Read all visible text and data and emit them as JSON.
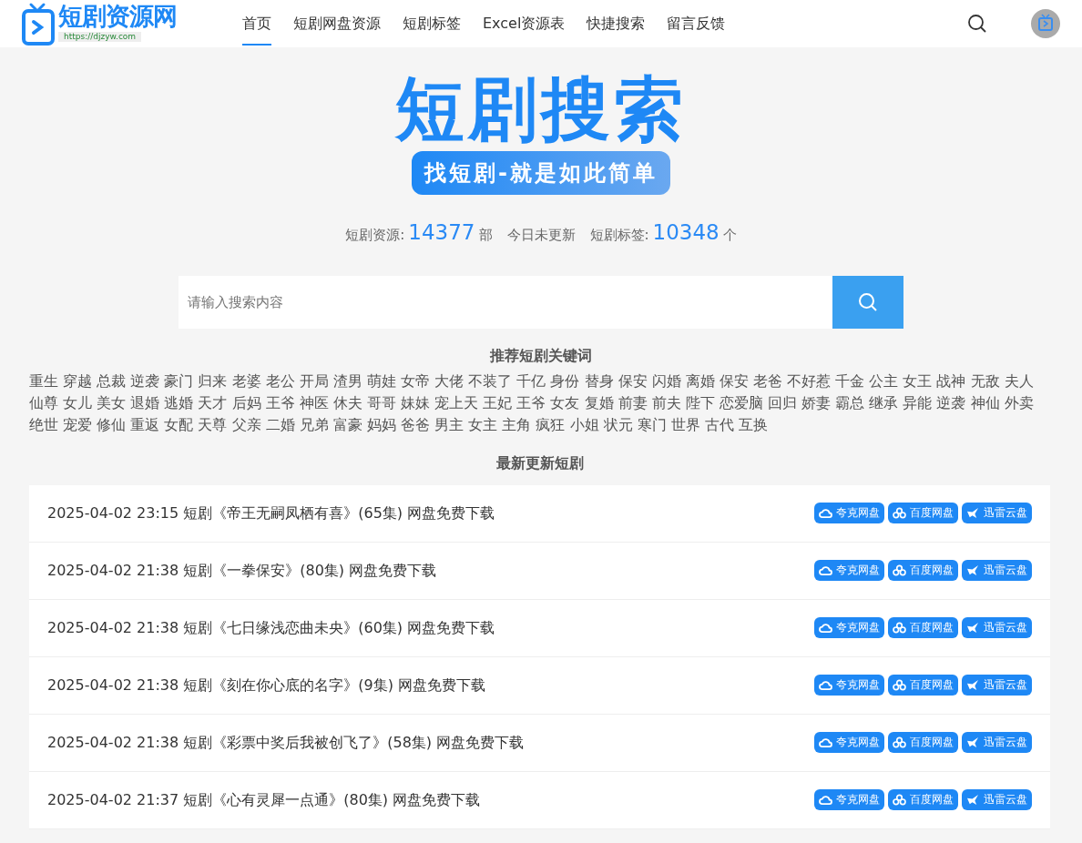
{
  "header": {
    "logo": {
      "name": "短剧资源网",
      "url": "https://djzyw.com"
    },
    "nav": [
      {
        "label": "首页",
        "selected": true
      },
      {
        "label": "短剧网盘资源",
        "selected": false
      },
      {
        "label": "短剧标签",
        "selected": false
      },
      {
        "label": "Excel资源表",
        "selected": false
      },
      {
        "label": "快捷搜索",
        "selected": false
      },
      {
        "label": "留言反馈",
        "selected": false
      }
    ]
  },
  "hero": {
    "title": "短剧搜索",
    "slogan": "找短剧-就是如此简单"
  },
  "stats": [
    {
      "label": "短剧资源:",
      "value": "14377",
      "unit": "部"
    },
    {
      "label": "今日未更新"
    },
    {
      "label": "短剧标签:",
      "value": "10348",
      "unit": "个"
    }
  ],
  "search": {
    "placeholder": "请输入搜索内容"
  },
  "keywords": {
    "title": "推荐短剧关键词",
    "items": [
      "重生",
      "穿越",
      "总裁",
      "逆袭",
      "豪门",
      "归来",
      "老婆",
      "老公",
      "开局",
      "渣男",
      "萌娃",
      "女帝",
      "大佬",
      "不装了",
      "千亿",
      "身份",
      "替身",
      "保安",
      "闪婚",
      "离婚",
      "保安",
      "老爸",
      "不好惹",
      "千金",
      "公主",
      "女王",
      "战神",
      "无敌",
      "夫人",
      "仙尊",
      "女儿",
      "美女",
      "退婚",
      "逃婚",
      "天才",
      "后妈",
      "王爷",
      "神医",
      "休夫",
      "哥哥",
      "妹妹",
      "宠上天",
      "王妃",
      "王爷",
      "女友",
      "复婚",
      "前妻",
      "前夫",
      "陛下",
      "恋爱脑",
      "回归",
      "娇妻",
      "霸总",
      "继承",
      "异能",
      "逆袭",
      "神仙",
      "外卖",
      "绝世",
      "宠爱",
      "修仙",
      "重返",
      "女配",
      "天尊",
      "父亲",
      "二婚",
      "兄弟",
      "富豪",
      "妈妈",
      "爸爸",
      "男主",
      "女主",
      "主角",
      "疯狂",
      "小姐",
      "状元",
      "寒门",
      "世界",
      "古代",
      "互换"
    ]
  },
  "latest": {
    "title": "最新更新短剧",
    "rows": [
      {
        "text": "2025-04-02 23:15 短剧《帝王无嗣凤栖有喜》(65集) 网盘免费下载",
        "links": [
          {
            "kind": "quark",
            "label": "夸克网盘"
          },
          {
            "kind": "baidu",
            "label": "百度网盘"
          },
          {
            "kind": "xunlei",
            "label": "迅雷云盘"
          }
        ]
      },
      {
        "text": "2025-04-02 21:38 短剧《一拳保安》(80集) 网盘免费下载",
        "links": [
          {
            "kind": "quark",
            "label": "夸克网盘"
          },
          {
            "kind": "baidu",
            "label": "百度网盘"
          },
          {
            "kind": "xunlei",
            "label": "迅雷云盘"
          }
        ]
      },
      {
        "text": "2025-04-02 21:38 短剧《七日缘浅恋曲未央》(60集) 网盘免费下载",
        "links": [
          {
            "kind": "quark",
            "label": "夸克网盘"
          },
          {
            "kind": "baidu",
            "label": "百度网盘"
          },
          {
            "kind": "xunlei",
            "label": "迅雷云盘"
          }
        ]
      },
      {
        "text": "2025-04-02 21:38 短剧《刻在你心底的名字》(9集) 网盘免费下载",
        "links": [
          {
            "kind": "quark",
            "label": "夸克网盘"
          },
          {
            "kind": "baidu",
            "label": "百度网盘"
          },
          {
            "kind": "xunlei",
            "label": "迅雷云盘"
          }
        ]
      },
      {
        "text": "2025-04-02 21:38 短剧《彩票中奖后我被创飞了》(58集) 网盘免费下载",
        "links": [
          {
            "kind": "quark",
            "label": "夸克网盘"
          },
          {
            "kind": "baidu",
            "label": "百度网盘"
          },
          {
            "kind": "xunlei",
            "label": "迅雷云盘"
          }
        ]
      },
      {
        "text": "2025-04-02 21:37 短剧《心有灵犀一点通》(80集) 网盘免费下载",
        "links": [
          {
            "kind": "quark",
            "label": "夸克网盘"
          },
          {
            "kind": "baidu",
            "label": "百度网盘"
          },
          {
            "kind": "xunlei",
            "label": "迅雷云盘"
          }
        ]
      }
    ]
  }
}
